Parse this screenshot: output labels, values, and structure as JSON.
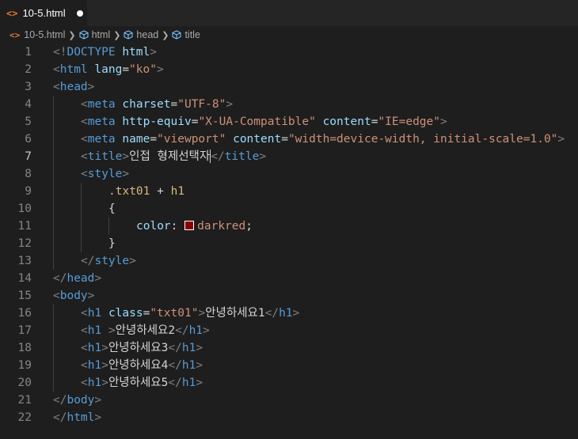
{
  "tab": {
    "label": "10-5.html",
    "icon": "html-file-icon",
    "modified": true
  },
  "breadcrumb": {
    "items": [
      {
        "label": "10-5.html",
        "icon": "html-file-icon"
      },
      {
        "label": "html",
        "icon": "element-cube-icon"
      },
      {
        "label": "head",
        "icon": "element-cube-icon"
      },
      {
        "label": "title",
        "icon": "element-cube-icon"
      }
    ]
  },
  "editor": {
    "active_line": 7,
    "line_numbers": [
      "1",
      "2",
      "3",
      "4",
      "5",
      "6",
      "7",
      "8",
      "9",
      "10",
      "11",
      "12",
      "13",
      "14",
      "15",
      "16",
      "17",
      "18",
      "19",
      "20",
      "21",
      "22"
    ],
    "lines": [
      {
        "indent": 0,
        "tokens": [
          [
            "t",
            "<!"
          ],
          [
            "tn",
            "DOCTYPE"
          ],
          [
            "tx",
            " "
          ],
          [
            "an",
            "html"
          ],
          [
            "t",
            ">"
          ]
        ]
      },
      {
        "indent": 0,
        "tokens": [
          [
            "t",
            "<"
          ],
          [
            "tn",
            "html"
          ],
          [
            "tx",
            " "
          ],
          [
            "an",
            "lang"
          ],
          [
            "tx",
            "="
          ],
          [
            "av",
            "\"ko\""
          ],
          [
            "t",
            ">"
          ]
        ]
      },
      {
        "indent": 0,
        "tokens": [
          [
            "t",
            "<"
          ],
          [
            "tn",
            "head"
          ],
          [
            "t",
            ">"
          ]
        ]
      },
      {
        "indent": 1,
        "tokens": [
          [
            "t",
            "<"
          ],
          [
            "tn",
            "meta"
          ],
          [
            "tx",
            " "
          ],
          [
            "an",
            "charset"
          ],
          [
            "tx",
            "="
          ],
          [
            "av",
            "\"UTF-8\""
          ],
          [
            "t",
            ">"
          ]
        ]
      },
      {
        "indent": 1,
        "tokens": [
          [
            "t",
            "<"
          ],
          [
            "tn",
            "meta"
          ],
          [
            "tx",
            " "
          ],
          [
            "an",
            "http-equiv"
          ],
          [
            "tx",
            "="
          ],
          [
            "av",
            "\"X-UA-Compatible\""
          ],
          [
            "tx",
            " "
          ],
          [
            "an",
            "content"
          ],
          [
            "tx",
            "="
          ],
          [
            "av",
            "\"IE=edge\""
          ],
          [
            "t",
            ">"
          ]
        ]
      },
      {
        "indent": 1,
        "tokens": [
          [
            "t",
            "<"
          ],
          [
            "tn",
            "meta"
          ],
          [
            "tx",
            " "
          ],
          [
            "an",
            "name"
          ],
          [
            "tx",
            "="
          ],
          [
            "av",
            "\"viewport\""
          ],
          [
            "tx",
            " "
          ],
          [
            "an",
            "content"
          ],
          [
            "tx",
            "="
          ],
          [
            "av",
            "\"width=device-width, initial-scale=1.0\""
          ],
          [
            "t",
            ">"
          ]
        ]
      },
      {
        "indent": 1,
        "tokens": [
          [
            "t",
            "<"
          ],
          [
            "tn",
            "title"
          ],
          [
            "t",
            ">"
          ],
          [
            "tx",
            "인접 형제선택자"
          ],
          [
            "cursor",
            ""
          ],
          [
            "t",
            "</"
          ],
          [
            "tn",
            "title"
          ],
          [
            "t",
            ">"
          ]
        ]
      },
      {
        "indent": 1,
        "tokens": [
          [
            "t",
            "<"
          ],
          [
            "tn",
            "style"
          ],
          [
            "t",
            ">"
          ]
        ]
      },
      {
        "indent": 2,
        "tokens": [
          [
            "sel",
            ".txt01"
          ],
          [
            "tx",
            " + "
          ],
          [
            "sel",
            "h1"
          ]
        ]
      },
      {
        "indent": 2,
        "tokens": [
          [
            "tx",
            "{"
          ]
        ]
      },
      {
        "indent": 3,
        "tokens": [
          [
            "an",
            "color"
          ],
          [
            "tx",
            ": "
          ],
          [
            "swatch",
            ""
          ],
          [
            "av",
            "darkred"
          ],
          [
            "tx",
            ";"
          ]
        ]
      },
      {
        "indent": 2,
        "tokens": [
          [
            "tx",
            "}"
          ]
        ]
      },
      {
        "indent": 1,
        "tokens": [
          [
            "t",
            "</"
          ],
          [
            "tn",
            "style"
          ],
          [
            "t",
            ">"
          ]
        ]
      },
      {
        "indent": 0,
        "tokens": [
          [
            "t",
            "</"
          ],
          [
            "tn",
            "head"
          ],
          [
            "t",
            ">"
          ]
        ]
      },
      {
        "indent": 0,
        "tokens": [
          [
            "t",
            "<"
          ],
          [
            "tn",
            "body"
          ],
          [
            "t",
            ">"
          ]
        ]
      },
      {
        "indent": 1,
        "tokens": [
          [
            "t",
            "<"
          ],
          [
            "tn",
            "h1"
          ],
          [
            "tx",
            " "
          ],
          [
            "an",
            "class"
          ],
          [
            "tx",
            "="
          ],
          [
            "av",
            "\"txt01\""
          ],
          [
            "t",
            ">"
          ],
          [
            "tx",
            "안녕하세요1"
          ],
          [
            "t",
            "</"
          ],
          [
            "tn",
            "h1"
          ],
          [
            "t",
            ">"
          ]
        ]
      },
      {
        "indent": 1,
        "tokens": [
          [
            "t",
            "<"
          ],
          [
            "tn",
            "h1"
          ],
          [
            "tx",
            " "
          ],
          [
            "t",
            ">"
          ],
          [
            "tx",
            "안녕하세요2"
          ],
          [
            "t",
            "</"
          ],
          [
            "tn",
            "h1"
          ],
          [
            "t",
            ">"
          ]
        ]
      },
      {
        "indent": 1,
        "tokens": [
          [
            "t",
            "<"
          ],
          [
            "tn",
            "h1"
          ],
          [
            "t",
            ">"
          ],
          [
            "tx",
            "안녕하세요3"
          ],
          [
            "t",
            "</"
          ],
          [
            "tn",
            "h1"
          ],
          [
            "t",
            ">"
          ]
        ]
      },
      {
        "indent": 1,
        "tokens": [
          [
            "t",
            "<"
          ],
          [
            "tn",
            "h1"
          ],
          [
            "t",
            ">"
          ],
          [
            "tx",
            "안녕하세요4"
          ],
          [
            "t",
            "</"
          ],
          [
            "tn",
            "h1"
          ],
          [
            "t",
            ">"
          ]
        ]
      },
      {
        "indent": 1,
        "tokens": [
          [
            "t",
            "<"
          ],
          [
            "tn",
            "h1"
          ],
          [
            "t",
            ">"
          ],
          [
            "tx",
            "안녕하세요5"
          ],
          [
            "t",
            "</"
          ],
          [
            "tn",
            "h1"
          ],
          [
            "t",
            ">"
          ]
        ]
      },
      {
        "indent": 0,
        "tokens": [
          [
            "t",
            "</"
          ],
          [
            "tn",
            "body"
          ],
          [
            "t",
            ">"
          ]
        ]
      },
      {
        "indent": 0,
        "tokens": [
          [
            "t",
            "</"
          ],
          [
            "tn",
            "html"
          ],
          [
            "t",
            ">"
          ]
        ]
      }
    ]
  },
  "colors": {
    "background": "#1e1e1e",
    "tag_bracket": "#808080",
    "tag_name": "#569cd6",
    "attribute_name": "#9cdcfe",
    "attribute_value": "#ce9178",
    "selector": "#d7ba7d",
    "color_swatch": "#8b0000"
  }
}
